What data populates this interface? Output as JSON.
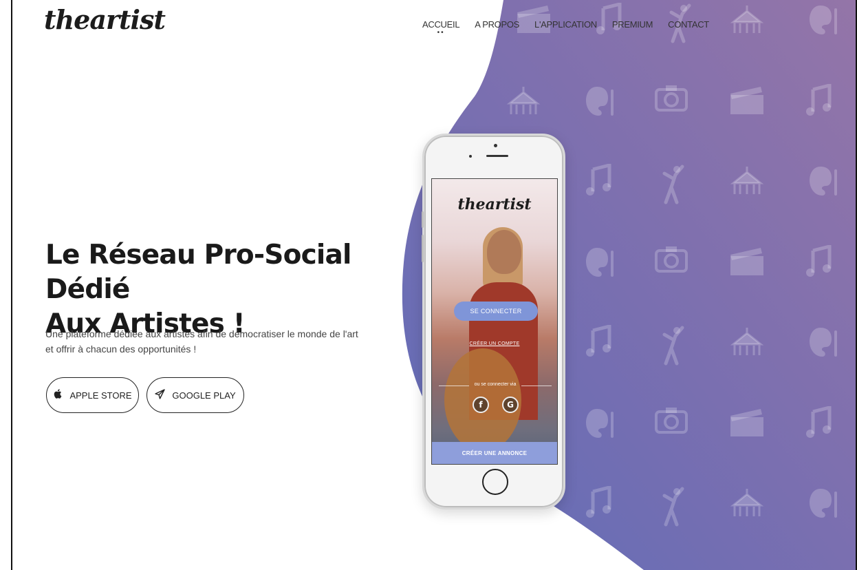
{
  "brand": {
    "logo_text": "theartist"
  },
  "nav": {
    "items": [
      {
        "label": "ACCUEIL"
      },
      {
        "label": "A PROPOS"
      },
      {
        "label": "L'APPLICATION"
      },
      {
        "label": "PREMIUM"
      },
      {
        "label": "CONTACT"
      }
    ]
  },
  "hero": {
    "title_line1": "Le Réseau Pro-Social Dédié",
    "title_line2": "Aux Artistes !",
    "subtitle": "Une plateforme dédiée aux artistes afin de démocratiser le monde de l'art et offrir à chacun des opportunités !",
    "apple_button": "APPLE STORE",
    "google_button": "GOOGLE PLAY"
  },
  "phone_screen": {
    "logo_text": "theartist",
    "login_button": "SE CONNECTER",
    "create_account_link": "CRÉER UN COMPTE",
    "or_connect_via": "ou se connecter via",
    "facebook_glyph": "f",
    "google_glyph": "G",
    "footer_button": "CRÉER UNE ANNONCE"
  },
  "colors": {
    "purple_start": "#6a72b8",
    "purple_end": "#8a6ea8",
    "accent_button": "#7f95d8"
  },
  "pattern_icons": [
    "circus-tent-icon",
    "palette-icon",
    "camera-icon",
    "clapperboard-icon",
    "music-note-icon",
    "dancer-icon"
  ]
}
